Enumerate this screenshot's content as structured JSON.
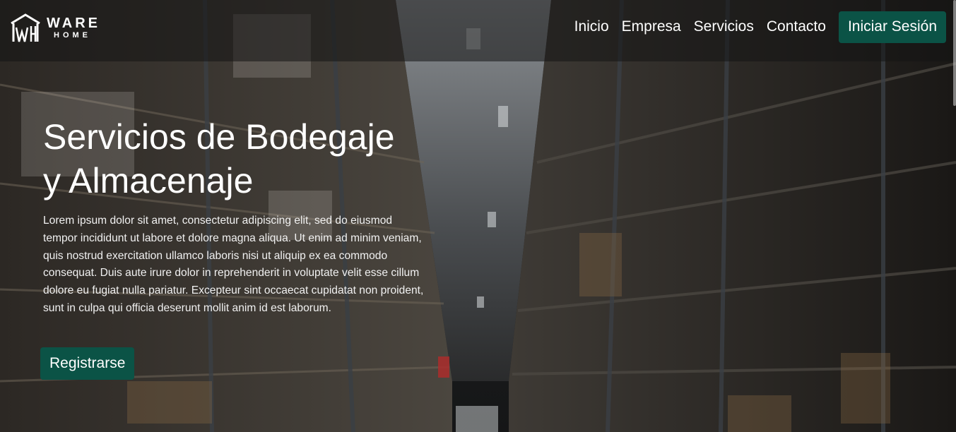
{
  "logo": {
    "word1": "WARE",
    "word2": "HOME",
    "icon": "warehouse-logo-icon"
  },
  "nav": {
    "links": [
      "Inicio",
      "Empresa",
      "Servicios",
      "Contacto"
    ],
    "login_label": "Iniciar Sesión"
  },
  "hero": {
    "title_line1": "Servicios de Bodegaje",
    "title_line2": "y Almacenaje",
    "text": "Lorem ipsum dolor sit amet, consectetur adipiscing elit, sed do eiusmod tempor incididunt ut labore et dolore magna aliqua. Ut enim ad minim veniam, quis nostrud exercitation ullamco laboris nisi ut aliquip ex ea commodo consequat. Duis aute irure dolor in reprehenderit in voluptate velit esse cillum dolore eu fugiat nulla pariatur. Excepteur sint occaecat cupidatat non proident, sunt in culpa qui officia deserunt mollit anim id est laborum.",
    "register_label": "Registrarse"
  },
  "colors": {
    "accent": "#0b5346",
    "nav_bg": "#141414"
  }
}
